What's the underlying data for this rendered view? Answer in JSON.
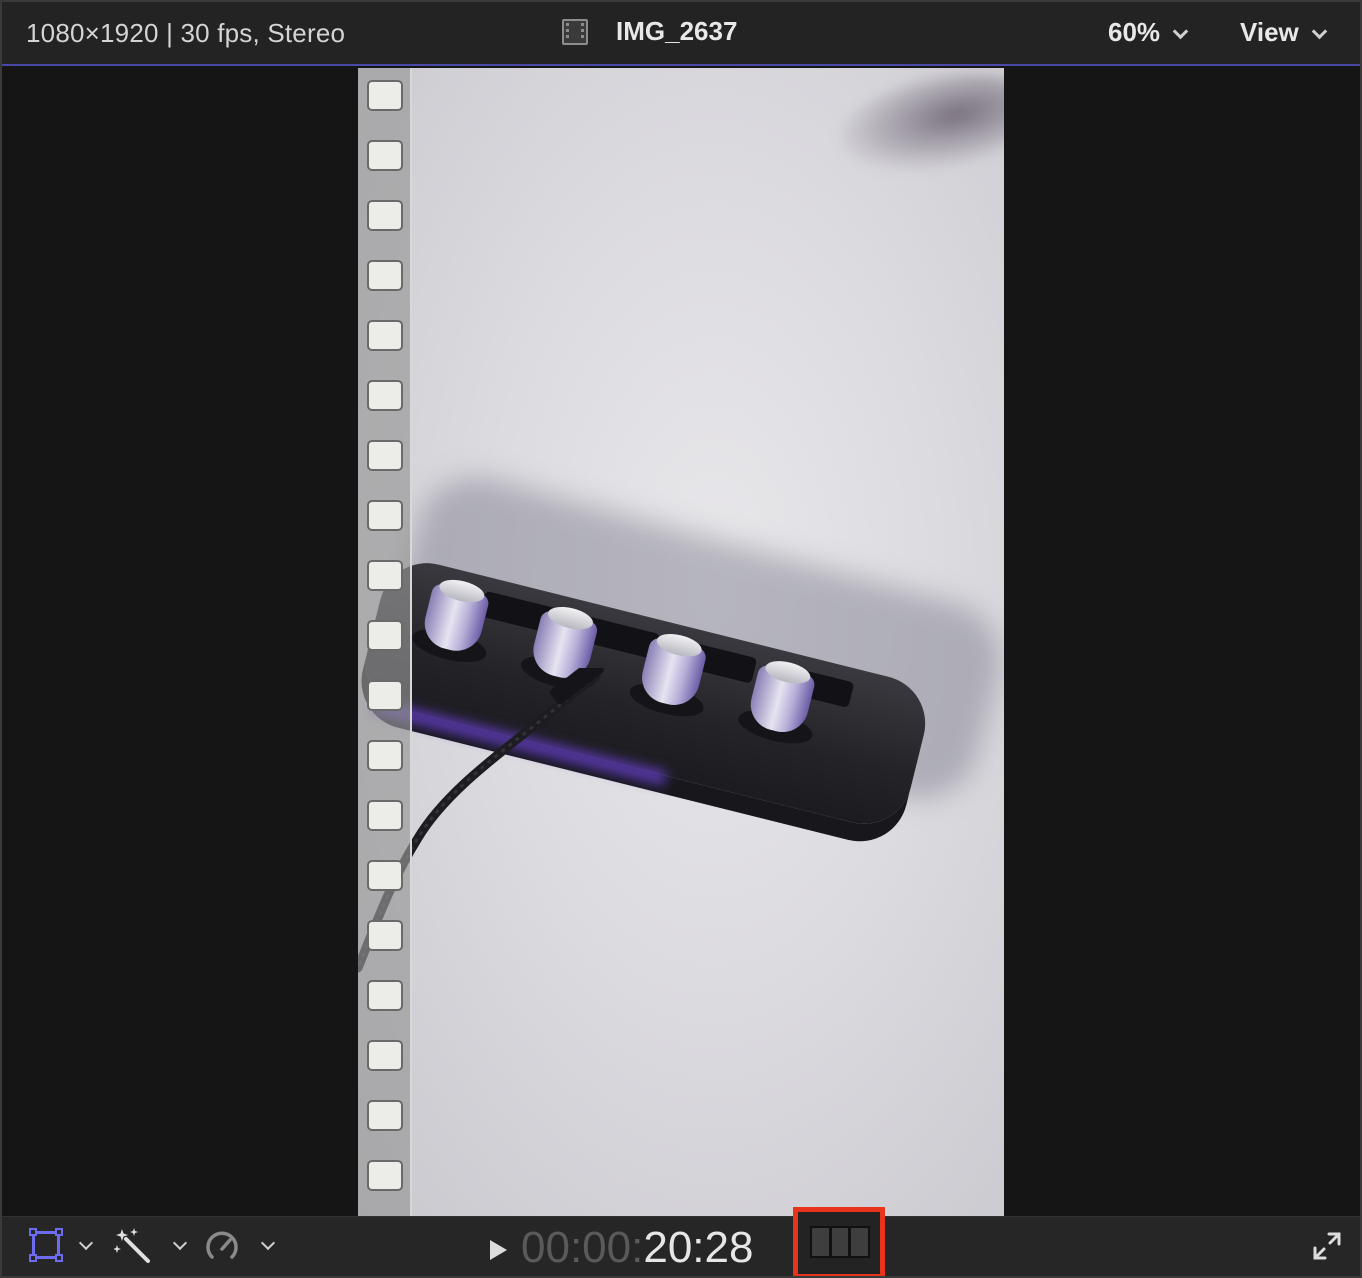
{
  "header": {
    "format_info": "1080×1920 | 30 fps, Stereo",
    "clip_name": "IMG_2637",
    "zoom_label": "60%",
    "view_label": "View"
  },
  "icons": {
    "clip": "film-icon",
    "transform": "transform-icon",
    "enhance": "magic-wand-icon",
    "retime": "speedometer-icon",
    "play": "play-icon",
    "viewer_layout": "filmstrip-icon",
    "fullscreen": "expand-icon"
  },
  "timecode": {
    "dim": "00:00:",
    "lit": "20:28"
  },
  "colors": {
    "accent": "#6d6cf0",
    "highlight": "#e8341c",
    "divider": "#4b49a8"
  }
}
